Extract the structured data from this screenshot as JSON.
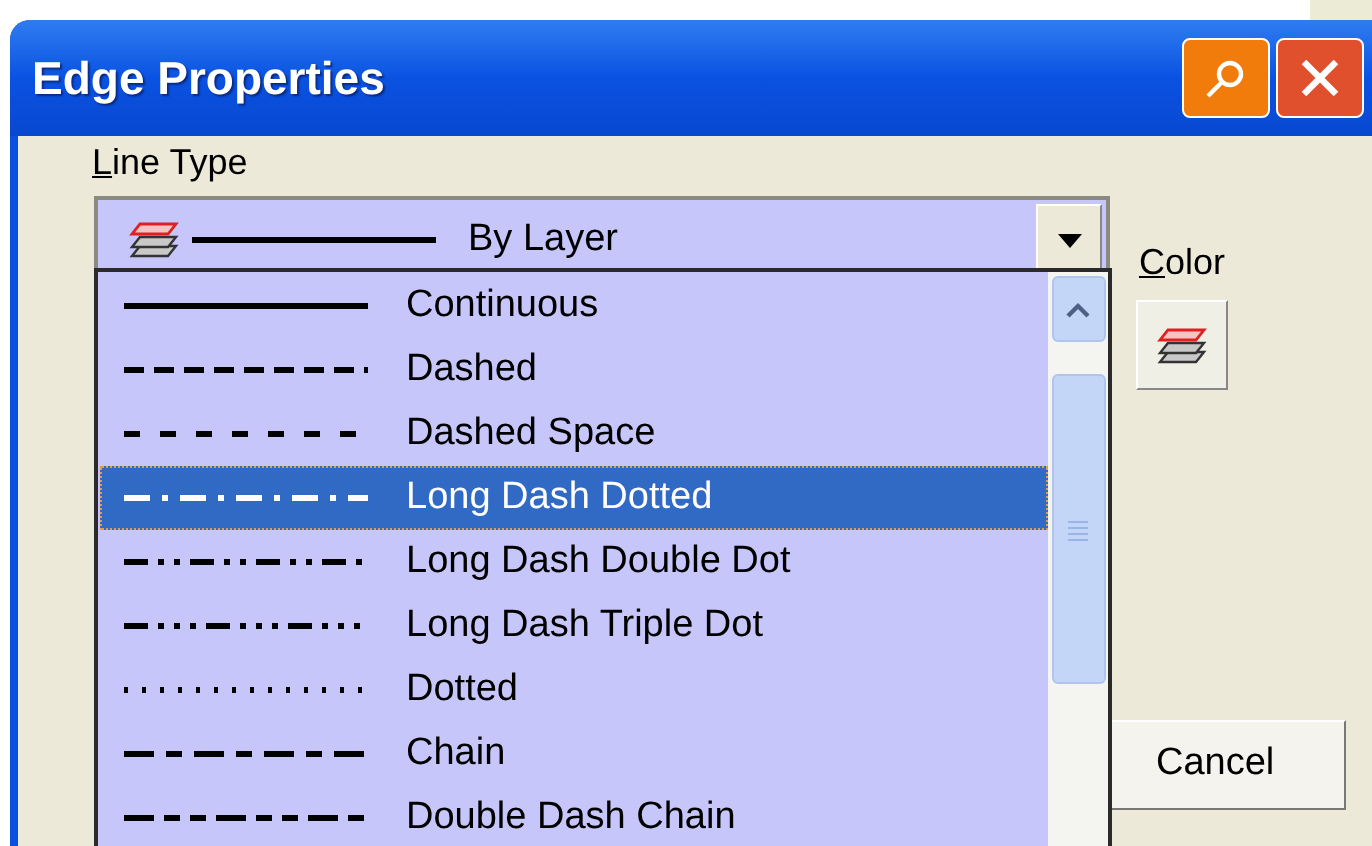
{
  "window": {
    "title": "Edge Properties"
  },
  "line_type": {
    "label": "Line Type",
    "value": "By Layer",
    "expanded": true
  },
  "line_types": [
    {
      "label": "Continuous",
      "kind": "continuous",
      "selected": false
    },
    {
      "label": "Dashed",
      "kind": "dashed",
      "selected": false
    },
    {
      "label": "Dashed Space",
      "kind": "dashed-space",
      "selected": false
    },
    {
      "label": "Long Dash Dotted",
      "kind": "long-dash-dotted",
      "selected": true
    },
    {
      "label": "Long Dash Double Dot",
      "kind": "long-dash-double-dot",
      "selected": false
    },
    {
      "label": "Long Dash Triple Dot",
      "kind": "long-dash-triple-dot",
      "selected": false
    },
    {
      "label": "Dotted",
      "kind": "dotted",
      "selected": false
    },
    {
      "label": "Chain",
      "kind": "chain",
      "selected": false
    },
    {
      "label": "Double Dash Chain",
      "kind": "double-dash-chain",
      "selected": false
    }
  ],
  "color": {
    "label": "Color"
  },
  "buttons": [
    "Cancel"
  ]
}
